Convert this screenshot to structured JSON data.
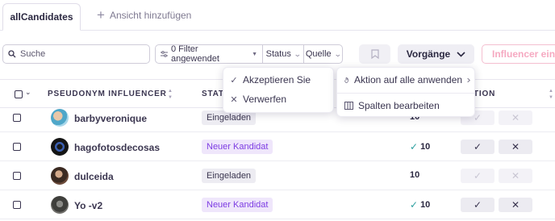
{
  "tabs": {
    "active_label": "allCandidates",
    "add_label": "Ansicht hinzufügen"
  },
  "toolbar": {
    "search_placeholder": "Suche",
    "filter_label": "0 Filter angewendet",
    "status_label": "Status",
    "quelle_label": "Quelle",
    "vorgaenge_label": "Vorgänge",
    "invite_label": "Influencer einla"
  },
  "table": {
    "headers": {
      "influencer": "PSEUDONYM INFLUENCER",
      "status": "STAT",
      "action": "TION"
    },
    "rows": [
      {
        "name": "barbyveronique",
        "status": "Eingeladen",
        "status_kind": "gray",
        "score": "10",
        "score_check": false
      },
      {
        "name": "hagofotosdecosas",
        "status": "Neuer Kandidat",
        "status_kind": "purple",
        "score": "10",
        "score_check": true
      },
      {
        "name": "dulceida",
        "status": "Eingeladen",
        "status_kind": "gray",
        "score": "10",
        "score_check": false
      },
      {
        "name": "Yo -v2",
        "status": "Neuer Kandidat",
        "status_kind": "purple",
        "score": "10",
        "score_check": true
      }
    ]
  },
  "status_menu": {
    "accept_label": "Akzeptieren Sie",
    "reject_label": "Verwerfen"
  },
  "actions_menu": {
    "apply_all_label": "Aktion auf alle anwenden",
    "edit_columns_label": "Spalten bearbeiten"
  },
  "colors": {
    "accent_purple": "#7d3ce3",
    "invite_pink": "#f6a9c1",
    "check_teal": "#2ea0a0"
  }
}
